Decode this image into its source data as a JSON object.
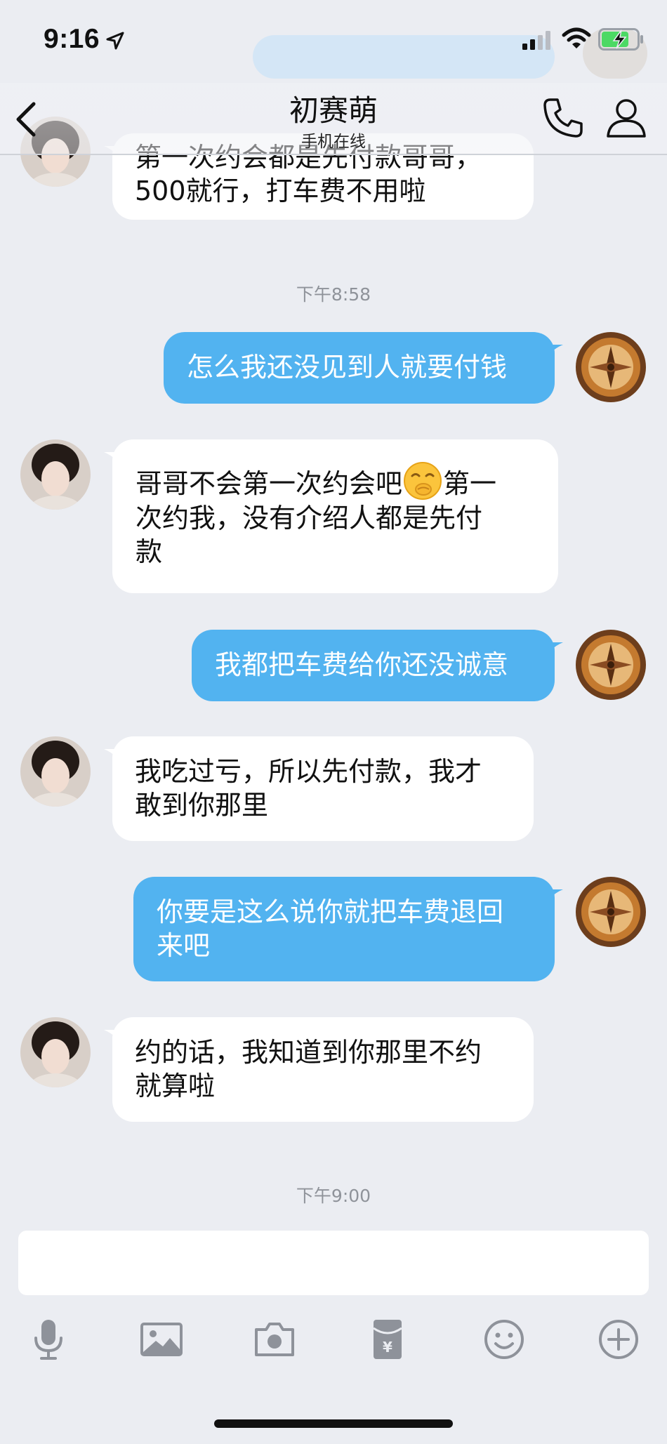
{
  "status_bar": {
    "time": "9:16"
  },
  "header": {
    "contact_name": "初赛萌",
    "contact_status": "手机在线"
  },
  "messages": [
    {
      "direction": "in",
      "lines": [
        "第一次约会都是先付款哥哥，",
        "500就行，打车费不用啦"
      ]
    },
    {
      "type": "timestamp",
      "text": "下午8:58"
    },
    {
      "direction": "out",
      "lines": [
        "怎么我还没见到人就要付钱"
      ]
    },
    {
      "direction": "in",
      "lines": [
        "哥哥不会第一次约会吧",
        "第一",
        "次约我，没有介绍人都是先付",
        "款"
      ],
      "emoji": "shush-face-emoji"
    },
    {
      "direction": "out",
      "lines": [
        "我都把车费给你还没诚意"
      ]
    },
    {
      "direction": "in",
      "lines": [
        "我吃过亏，所以先付款，我才",
        "敢到你那里"
      ]
    },
    {
      "direction": "out",
      "lines": [
        "你要是这么说你就把车费退回",
        "来吧"
      ]
    },
    {
      "direction": "in",
      "lines": [
        "约的话，我知道到你那里不约",
        "就算啦"
      ]
    },
    {
      "type": "timestamp",
      "text": "下午9:00"
    }
  ],
  "input": {
    "value": ""
  },
  "toolbar": [
    "microphone-icon",
    "image-icon",
    "camera-icon",
    "red-packet-icon",
    "emoji-icon",
    "plus-icon"
  ],
  "colors": {
    "outgoing_bubble": "#52b3f0",
    "incoming_bubble": "#ffffff",
    "background": "#ebedf2"
  }
}
